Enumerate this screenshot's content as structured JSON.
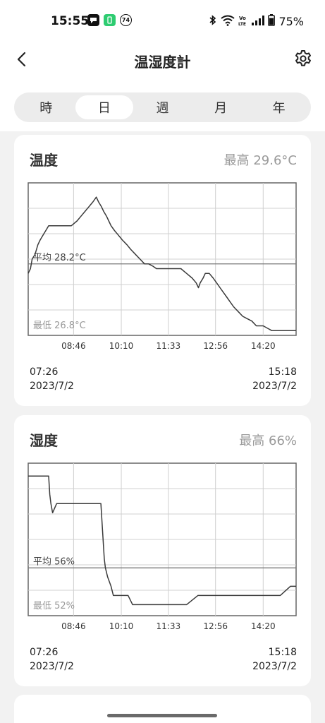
{
  "status_bar": {
    "time": "15:55",
    "app_badges": [
      {
        "icon": "chat-bubble-icon",
        "color": "#111111"
      },
      {
        "icon": "phone-app-icon",
        "color": "#2ecc71"
      },
      {
        "icon": "notification-74-icon",
        "label": "74",
        "color": "#111111"
      }
    ],
    "icons": [
      "bluetooth-icon",
      "wifi-icon",
      "volte-icon",
      "signal-icon",
      "battery-icon"
    ],
    "volte_label": "Vo\nLTE",
    "battery": "75%"
  },
  "header": {
    "title": "温湿度計",
    "back_icon": "chevron-left-icon",
    "settings_icon": "gear-icon"
  },
  "tabs": {
    "items": [
      {
        "label": "時"
      },
      {
        "label": "日"
      },
      {
        "label": "週"
      },
      {
        "label": "月"
      },
      {
        "label": "年"
      }
    ],
    "active_index": 1
  },
  "temperature": {
    "title": "温度",
    "max_label": "最高 29.6°C",
    "avg_label": "平均 28.2°C",
    "min_label": "最低 26.8°C",
    "start_time": "07:26",
    "start_date": "2023/7/2",
    "end_time": "15:18",
    "end_date": "2023/7/2"
  },
  "humidity": {
    "title": "湿度",
    "max_label": "最高 66%",
    "avg_label": "平均 56%",
    "min_label": "最低 52%",
    "start_time": "07:26",
    "start_date": "2023/7/2",
    "end_time": "15:18",
    "end_date": "2023/7/2"
  },
  "chart_data": [
    {
      "type": "line",
      "title": "温度",
      "x_tick_labels": [
        "08:46",
        "10:10",
        "11:33",
        "12:56",
        "14:20"
      ],
      "xlim": [
        "07:26",
        "15:18"
      ],
      "ylim": [
        26.7,
        29.9
      ],
      "unit": "°C",
      "max": 29.6,
      "avg": 28.2,
      "min": 26.8,
      "grid": true,
      "series": [
        {
          "x": [
            "07:26",
            "07:30",
            "07:33",
            "07:38",
            "07:43",
            "07:47",
            "07:52",
            "07:57",
            "08:02",
            "08:12",
            "08:22",
            "08:32",
            "08:42",
            "08:52",
            "08:59",
            "09:06",
            "09:13",
            "09:20",
            "09:26",
            "09:30",
            "09:35",
            "09:39",
            "09:44",
            "09:48",
            "09:52",
            "09:58",
            "10:05",
            "10:12",
            "10:20",
            "10:27",
            "10:35",
            "10:43",
            "10:51",
            "10:58",
            "11:06",
            "11:12",
            "11:17",
            "11:25",
            "11:33",
            "11:45",
            "11:55",
            "12:05",
            "12:15",
            "12:22",
            "12:26",
            "12:29",
            "12:34",
            "12:38",
            "12:45",
            "12:52",
            "12:58",
            "13:04",
            "13:10",
            "13:16",
            "13:22",
            "13:28",
            "13:36",
            "13:44",
            "13:52",
            "14:00",
            "14:08",
            "14:20",
            "14:35",
            "14:50",
            "15:05",
            "15:18"
          ],
          "y": [
            28.0,
            28.1,
            28.3,
            28.4,
            28.6,
            28.7,
            28.8,
            28.9,
            29.0,
            29.0,
            29.0,
            29.0,
            29.0,
            29.1,
            29.2,
            29.3,
            29.4,
            29.5,
            29.6,
            29.5,
            29.4,
            29.3,
            29.2,
            29.1,
            29.0,
            28.9,
            28.8,
            28.7,
            28.6,
            28.5,
            28.4,
            28.3,
            28.2,
            28.2,
            28.15,
            28.1,
            28.1,
            28.1,
            28.1,
            28.1,
            28.1,
            28.0,
            27.9,
            27.8,
            27.7,
            27.8,
            27.9,
            28.0,
            28.0,
            27.9,
            27.8,
            27.7,
            27.6,
            27.5,
            27.4,
            27.3,
            27.2,
            27.1,
            27.05,
            27.0,
            26.9,
            26.9,
            26.8,
            26.8,
            26.8,
            26.8
          ]
        }
      ]
    },
    {
      "type": "line",
      "title": "湿度",
      "x_tick_labels": [
        "08:46",
        "10:10",
        "11:33",
        "12:56",
        "14:20"
      ],
      "xlim": [
        "07:26",
        "15:18"
      ],
      "ylim": [
        50.8,
        67.4
      ],
      "unit": "%",
      "max": 66,
      "avg": 56,
      "min": 52,
      "grid": true,
      "series": [
        {
          "x": [
            "07:26",
            "08:02",
            "08:04",
            "08:06",
            "08:09",
            "08:16",
            "08:20",
            "09:34",
            "09:37",
            "09:40",
            "09:42",
            "09:46",
            "09:52",
            "09:56",
            "10:08",
            "10:12",
            "10:22",
            "10:30",
            "10:45",
            "11:06",
            "11:30",
            "11:50",
            "12:05",
            "12:25",
            "12:35",
            "13:05",
            "13:20",
            "13:40",
            "14:00",
            "14:30",
            "14:50",
            "15:08",
            "15:18"
          ],
          "y": [
            66,
            66,
            64,
            63,
            62,
            63,
            63,
            63,
            60,
            57,
            56,
            55,
            54,
            53,
            53,
            53,
            53,
            52,
            52,
            52,
            52,
            52,
            52,
            53,
            53,
            53,
            53,
            53,
            53,
            53,
            53,
            54,
            54
          ]
        }
      ]
    }
  ]
}
